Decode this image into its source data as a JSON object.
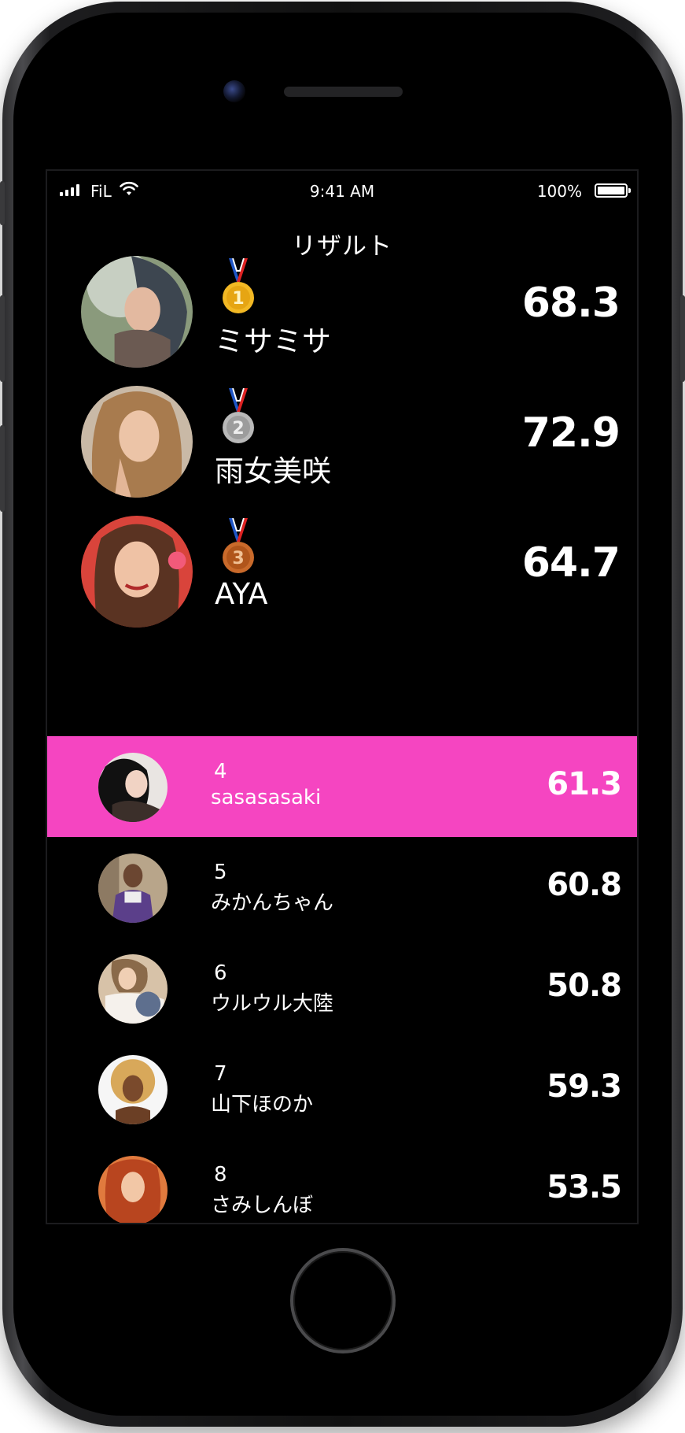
{
  "status_bar": {
    "carrier": "FiL",
    "time": "9:41 AM",
    "battery_percent": "100%",
    "icons": [
      "signal-bars-icon",
      "wifi-icon",
      "battery-icon"
    ]
  },
  "title": "リザルト",
  "top_three": [
    {
      "rank": 1,
      "medal": "gold-medal-icon",
      "medal_color": "#f2b824",
      "name": "ミサミサ",
      "score": "68.3"
    },
    {
      "rank": 2,
      "medal": "silver-medal-icon",
      "medal_color": "#a7a7a7",
      "name": "雨女美咲",
      "score": "72.9"
    },
    {
      "rank": 3,
      "medal": "bronze-medal-icon",
      "medal_color": "#c96a2b",
      "name": "AYA",
      "score": "64.7"
    }
  ],
  "ranking": [
    {
      "rank": "4",
      "name": "sasasasaki",
      "score": "61.3",
      "highlighted": true
    },
    {
      "rank": "5",
      "name": "みかんちゃん",
      "score": "60.8"
    },
    {
      "rank": "6",
      "name": "ウルウル大陸",
      "score": "50.8"
    },
    {
      "rank": "7",
      "name": "山下ほのか",
      "score": "59.3"
    },
    {
      "rank": "8",
      "name": "さみしんぼ",
      "score": "53.5"
    }
  ],
  "colors": {
    "highlight": "#f545c1",
    "background": "#000000",
    "text": "#ffffff"
  }
}
